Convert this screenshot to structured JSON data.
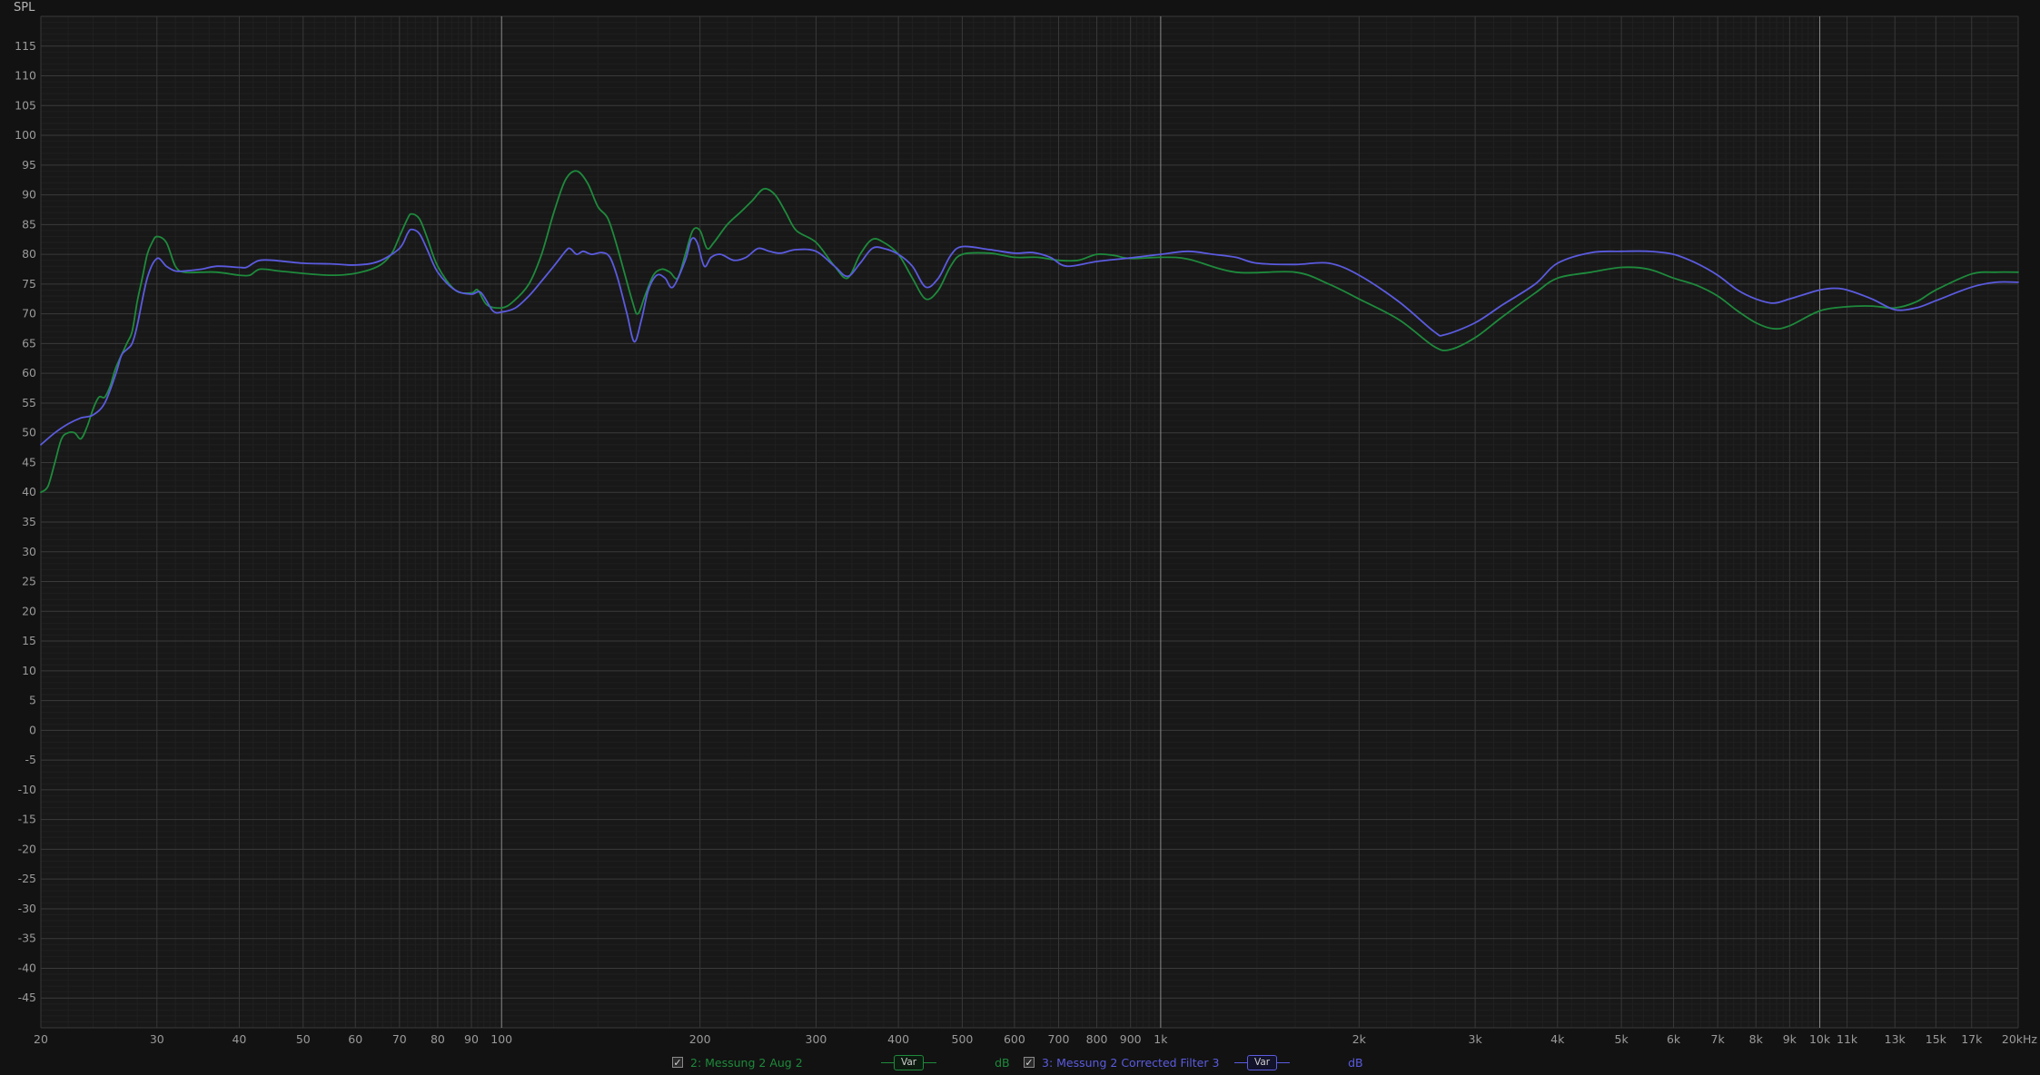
{
  "chart_data": {
    "type": "line",
    "title": "SPL",
    "x_scale": "log",
    "xlim": [
      20,
      20000
    ],
    "ylim": [
      -50,
      120
    ],
    "y_ticks": [
      115,
      110,
      105,
      100,
      95,
      90,
      85,
      80,
      75,
      70,
      65,
      60,
      55,
      50,
      45,
      40,
      35,
      30,
      25,
      20,
      15,
      10,
      5,
      0,
      -5,
      -10,
      -15,
      -20,
      -25,
      -30,
      -35,
      -40,
      -45
    ],
    "x_ticks": [
      {
        "v": 20,
        "label": "20"
      },
      {
        "v": 30,
        "label": "30"
      },
      {
        "v": 40,
        "label": "40"
      },
      {
        "v": 50,
        "label": "50"
      },
      {
        "v": 60,
        "label": "60"
      },
      {
        "v": 70,
        "label": "70"
      },
      {
        "v": 80,
        "label": "80"
      },
      {
        "v": 90,
        "label": "90"
      },
      {
        "v": 100,
        "label": "100"
      },
      {
        "v": 200,
        "label": "200"
      },
      {
        "v": 300,
        "label": "300"
      },
      {
        "v": 400,
        "label": "400"
      },
      {
        "v": 500,
        "label": "500"
      },
      {
        "v": 600,
        "label": "600"
      },
      {
        "v": 700,
        "label": "700"
      },
      {
        "v": 800,
        "label": "800"
      },
      {
        "v": 900,
        "label": "900"
      },
      {
        "v": 1000,
        "label": "1k"
      },
      {
        "v": 2000,
        "label": "2k"
      },
      {
        "v": 3000,
        "label": "3k"
      },
      {
        "v": 4000,
        "label": "4k"
      },
      {
        "v": 5000,
        "label": "5k"
      },
      {
        "v": 6000,
        "label": "6k"
      },
      {
        "v": 7000,
        "label": "7k"
      },
      {
        "v": 8000,
        "label": "8k"
      },
      {
        "v": 9000,
        "label": "9k"
      },
      {
        "v": 10000,
        "label": "10k"
      },
      {
        "v": 11000,
        "label": "11k"
      },
      {
        "v": 13000,
        "label": "13k"
      },
      {
        "v": 15000,
        "label": "15k"
      },
      {
        "v": 17000,
        "label": "17k"
      },
      {
        "v": 20000,
        "label": "20kHz"
      }
    ],
    "grid": true,
    "series": [
      {
        "name": "2: Messung 2 Aug 2",
        "color": "#1e8a3c",
        "points": [
          [
            20,
            40
          ],
          [
            20.5,
            41
          ],
          [
            21,
            45
          ],
          [
            21.5,
            49
          ],
          [
            22,
            50
          ],
          [
            22.5,
            50
          ],
          [
            23,
            49
          ],
          [
            23.5,
            51
          ],
          [
            24,
            54
          ],
          [
            24.5,
            56
          ],
          [
            25,
            56
          ],
          [
            25.5,
            58
          ],
          [
            26,
            61
          ],
          [
            27,
            65
          ],
          [
            27.5,
            67
          ],
          [
            28,
            72
          ],
          [
            28.5,
            76
          ],
          [
            29,
            80
          ],
          [
            29.5,
            82
          ],
          [
            30,
            83
          ],
          [
            31,
            82
          ],
          [
            32,
            78
          ],
          [
            33,
            77
          ],
          [
            35,
            77
          ],
          [
            37,
            77
          ],
          [
            40,
            76.5
          ],
          [
            41.5,
            76.5
          ],
          [
            43,
            77.5
          ],
          [
            46,
            77.2
          ],
          [
            50,
            76.8
          ],
          [
            55,
            76.5
          ],
          [
            60,
            76.8
          ],
          [
            65,
            78
          ],
          [
            68,
            80
          ],
          [
            70,
            83
          ],
          [
            72,
            86
          ],
          [
            73,
            86.8
          ],
          [
            75,
            86
          ],
          [
            77,
            83
          ],
          [
            80,
            78
          ],
          [
            85,
            74
          ],
          [
            90,
            73.5
          ],
          [
            92,
            74
          ],
          [
            95,
            71.5
          ],
          [
            100,
            71
          ],
          [
            104,
            72
          ],
          [
            110,
            75
          ],
          [
            115,
            80
          ],
          [
            120,
            87
          ],
          [
            125,
            92.5
          ],
          [
            130,
            94
          ],
          [
            135,
            92
          ],
          [
            140,
            88
          ],
          [
            145,
            86
          ],
          [
            150,
            81
          ],
          [
            158,
            72
          ],
          [
            161,
            70
          ],
          [
            165,
            73
          ],
          [
            170,
            76.5
          ],
          [
            175,
            77.5
          ],
          [
            180,
            77
          ],
          [
            185,
            76
          ],
          [
            190,
            80
          ],
          [
            195,
            84
          ],
          [
            200,
            84
          ],
          [
            205,
            81
          ],
          [
            210,
            82
          ],
          [
            220,
            85
          ],
          [
            230,
            87
          ],
          [
            240,
            89
          ],
          [
            250,
            91
          ],
          [
            260,
            90
          ],
          [
            270,
            87
          ],
          [
            280,
            84
          ],
          [
            300,
            82
          ],
          [
            320,
            78
          ],
          [
            335,
            76
          ],
          [
            350,
            80
          ],
          [
            365,
            82.5
          ],
          [
            380,
            82
          ],
          [
            400,
            80
          ],
          [
            420,
            76
          ],
          [
            440,
            72.5
          ],
          [
            460,
            74
          ],
          [
            480,
            78
          ],
          [
            500,
            80
          ],
          [
            550,
            80.2
          ],
          [
            600,
            79.5
          ],
          [
            650,
            79.5
          ],
          [
            700,
            79
          ],
          [
            750,
            79
          ],
          [
            800,
            80
          ],
          [
            850,
            79.8
          ],
          [
            900,
            79.3
          ],
          [
            1000,
            79.5
          ],
          [
            1100,
            79.2
          ],
          [
            1300,
            77
          ],
          [
            1600,
            77
          ],
          [
            1800,
            75
          ],
          [
            2000,
            72.5
          ],
          [
            2300,
            69
          ],
          [
            2600,
            64.5
          ],
          [
            2750,
            64
          ],
          [
            3000,
            66
          ],
          [
            3300,
            69.5
          ],
          [
            3700,
            73.5
          ],
          [
            4000,
            76
          ],
          [
            4500,
            77
          ],
          [
            5000,
            77.8
          ],
          [
            5500,
            77.5
          ],
          [
            6000,
            76
          ],
          [
            6500,
            74.8
          ],
          [
            7000,
            73
          ],
          [
            7500,
            70.5
          ],
          [
            8000,
            68.5
          ],
          [
            8500,
            67.5
          ],
          [
            9000,
            68
          ],
          [
            10000,
            70.5
          ],
          [
            11000,
            71.2
          ],
          [
            12000,
            71.3
          ],
          [
            13000,
            71
          ],
          [
            14000,
            72
          ],
          [
            15000,
            74
          ],
          [
            17000,
            76.7
          ],
          [
            18500,
            77
          ],
          [
            20000,
            77
          ]
        ]
      },
      {
        "name": "3: Messung 2 Corrected Filter 3",
        "color": "#5b5be0",
        "points": [
          [
            20,
            48
          ],
          [
            21,
            50
          ],
          [
            22,
            51.5
          ],
          [
            23,
            52.5
          ],
          [
            24,
            53
          ],
          [
            25,
            55
          ],
          [
            26,
            60
          ],
          [
            26.5,
            63
          ],
          [
            27,
            64
          ],
          [
            27.5,
            65
          ],
          [
            28,
            68
          ],
          [
            29,
            76
          ],
          [
            30,
            79.3
          ],
          [
            31,
            78
          ],
          [
            32,
            77.2
          ],
          [
            33,
            77.2
          ],
          [
            35,
            77.5
          ],
          [
            37,
            78
          ],
          [
            40,
            77.8
          ],
          [
            41,
            77.8
          ],
          [
            42,
            78.5
          ],
          [
            43,
            79
          ],
          [
            45,
            79
          ],
          [
            50,
            78.5
          ],
          [
            55,
            78.4
          ],
          [
            60,
            78.2
          ],
          [
            65,
            78.8
          ],
          [
            70,
            81
          ],
          [
            72,
            83.5
          ],
          [
            73,
            84.2
          ],
          [
            75,
            83.5
          ],
          [
            77,
            81
          ],
          [
            80,
            77
          ],
          [
            85,
            74
          ],
          [
            90,
            73.3
          ],
          [
            93,
            73.6
          ],
          [
            97,
            70.5
          ],
          [
            100,
            70.3
          ],
          [
            105,
            71
          ],
          [
            110,
            73
          ],
          [
            115,
            75.5
          ],
          [
            120,
            78
          ],
          [
            125,
            80.5
          ],
          [
            127,
            81
          ],
          [
            130,
            80
          ],
          [
            133,
            80.5
          ],
          [
            137,
            80
          ],
          [
            142,
            80.3
          ],
          [
            146,
            79.5
          ],
          [
            150,
            76
          ],
          [
            155,
            70
          ],
          [
            159,
            65.3
          ],
          [
            163,
            69
          ],
          [
            167,
            74
          ],
          [
            172,
            76.5
          ],
          [
            177,
            76
          ],
          [
            182,
            74.5
          ],
          [
            190,
            79
          ],
          [
            194,
            82.5
          ],
          [
            198,
            82
          ],
          [
            203,
            78
          ],
          [
            208,
            79.5
          ],
          [
            215,
            80
          ],
          [
            225,
            79
          ],
          [
            235,
            79.5
          ],
          [
            245,
            81
          ],
          [
            255,
            80.5
          ],
          [
            265,
            80.2
          ],
          [
            280,
            80.8
          ],
          [
            300,
            80.5
          ],
          [
            320,
            78
          ],
          [
            335,
            76.3
          ],
          [
            350,
            78.5
          ],
          [
            365,
            81
          ],
          [
            380,
            81
          ],
          [
            400,
            80
          ],
          [
            420,
            78
          ],
          [
            440,
            74.5
          ],
          [
            460,
            76
          ],
          [
            480,
            79.8
          ],
          [
            500,
            81.3
          ],
          [
            550,
            80.8
          ],
          [
            600,
            80.2
          ],
          [
            640,
            80.3
          ],
          [
            680,
            79.5
          ],
          [
            720,
            78
          ],
          [
            800,
            78.8
          ],
          [
            900,
            79.4
          ],
          [
            1000,
            80
          ],
          [
            1100,
            80.5
          ],
          [
            1200,
            80
          ],
          [
            1300,
            79.5
          ],
          [
            1400,
            78.5
          ],
          [
            1600,
            78.3
          ],
          [
            1800,
            78.5
          ],
          [
            2000,
            76.5
          ],
          [
            2300,
            72
          ],
          [
            2600,
            67
          ],
          [
            2700,
            66.5
          ],
          [
            3000,
            68.5
          ],
          [
            3300,
            71.5
          ],
          [
            3700,
            75
          ],
          [
            4000,
            78.5
          ],
          [
            4500,
            80.3
          ],
          [
            5000,
            80.5
          ],
          [
            5500,
            80.5
          ],
          [
            6000,
            80
          ],
          [
            6500,
            78.5
          ],
          [
            7000,
            76.5
          ],
          [
            7500,
            74
          ],
          [
            8000,
            72.5
          ],
          [
            8500,
            71.8
          ],
          [
            9000,
            72.5
          ],
          [
            9500,
            73.3
          ],
          [
            10000,
            74
          ],
          [
            10500,
            74.3
          ],
          [
            11000,
            74
          ],
          [
            12000,
            72.5
          ],
          [
            13000,
            70.7
          ],
          [
            14000,
            71
          ],
          [
            15000,
            72.2
          ],
          [
            17000,
            74.5
          ],
          [
            18500,
            75.3
          ],
          [
            20000,
            75.3
          ]
        ]
      }
    ]
  },
  "legend": [
    {
      "checked": "✓",
      "name": "2: Messung 2 Aug 2",
      "var_label": "Var",
      "unit": "dB",
      "color": "#1e8a3c"
    },
    {
      "checked": "✓",
      "name": "3: Messung 2 Corrected Filter 3",
      "var_label": "Var",
      "unit": "dB",
      "color": "#5b5be0"
    }
  ]
}
